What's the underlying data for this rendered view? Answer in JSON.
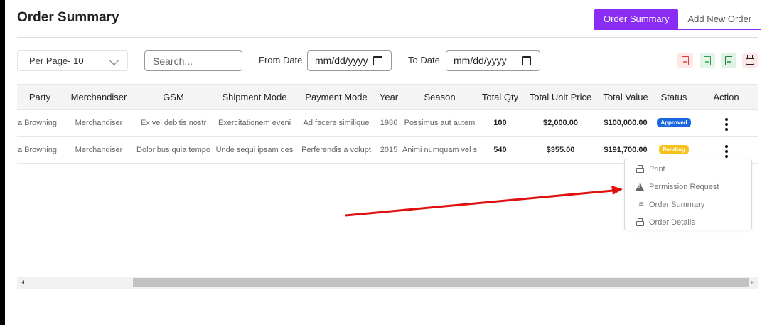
{
  "page": {
    "title": "Order Summary"
  },
  "tabs": [
    {
      "label": "Order Summary",
      "active": true
    },
    {
      "label": "Add New Order",
      "active": false
    }
  ],
  "filters": {
    "per_page": "Per Page- 10",
    "search_placeholder": "Search...",
    "from_label": "From Date",
    "from_value": "mm/dd/yyyy",
    "to_label": "To Date",
    "to_value": "mm/dd/yyyy"
  },
  "export_icons": [
    {
      "name": "pdf-icon",
      "color": "#e53935",
      "bg": "#fde7e7"
    },
    {
      "name": "csv-icon",
      "color": "#2e9e4f",
      "bg": "#e3f5e8"
    },
    {
      "name": "excel-icon",
      "color": "#1e7d3b",
      "bg": "#e0f2e6"
    },
    {
      "name": "print-icon",
      "color": "#222222",
      "bg": "#fde8e8"
    }
  ],
  "table": {
    "headers": [
      "Party",
      "Merchandiser",
      "GSM",
      "Shipment Mode",
      "Payment Mode",
      "Year",
      "Season",
      "Total Qty",
      "Total Unit Price",
      "Total Value",
      "Status",
      "Action"
    ],
    "rows": [
      {
        "party": "a Browning",
        "merchandiser": "Merchandiser",
        "gsm": "Ex vel debitis nostr",
        "shipment": "Exercitationem eveni",
        "payment": "Ad facere similique",
        "year": "1986",
        "season": "Possimus aut autem",
        "qty": "100",
        "unit_price": "$2,000.00",
        "value": "$100,000.00",
        "status": "Approved"
      },
      {
        "party": "a Browning",
        "merchandiser": "Merchandiser",
        "gsm": "Doloribus quia tempo",
        "shipment": "Unde sequi ipsam des",
        "payment": "Perferendis a volupt",
        "year": "2015",
        "season": "Animi numquam vel s",
        "qty": "540",
        "unit_price": "$355.00",
        "value": "$191,700.00",
        "status": "Pending"
      }
    ]
  },
  "action_menu": {
    "items": [
      "Print",
      "Permission Request",
      "Order Summary",
      "Order Details"
    ]
  },
  "colors": {
    "accent": "#8b2cf5",
    "approved": "#1a66e0",
    "pending": "#f7c21b",
    "arrow": "#e01010"
  }
}
